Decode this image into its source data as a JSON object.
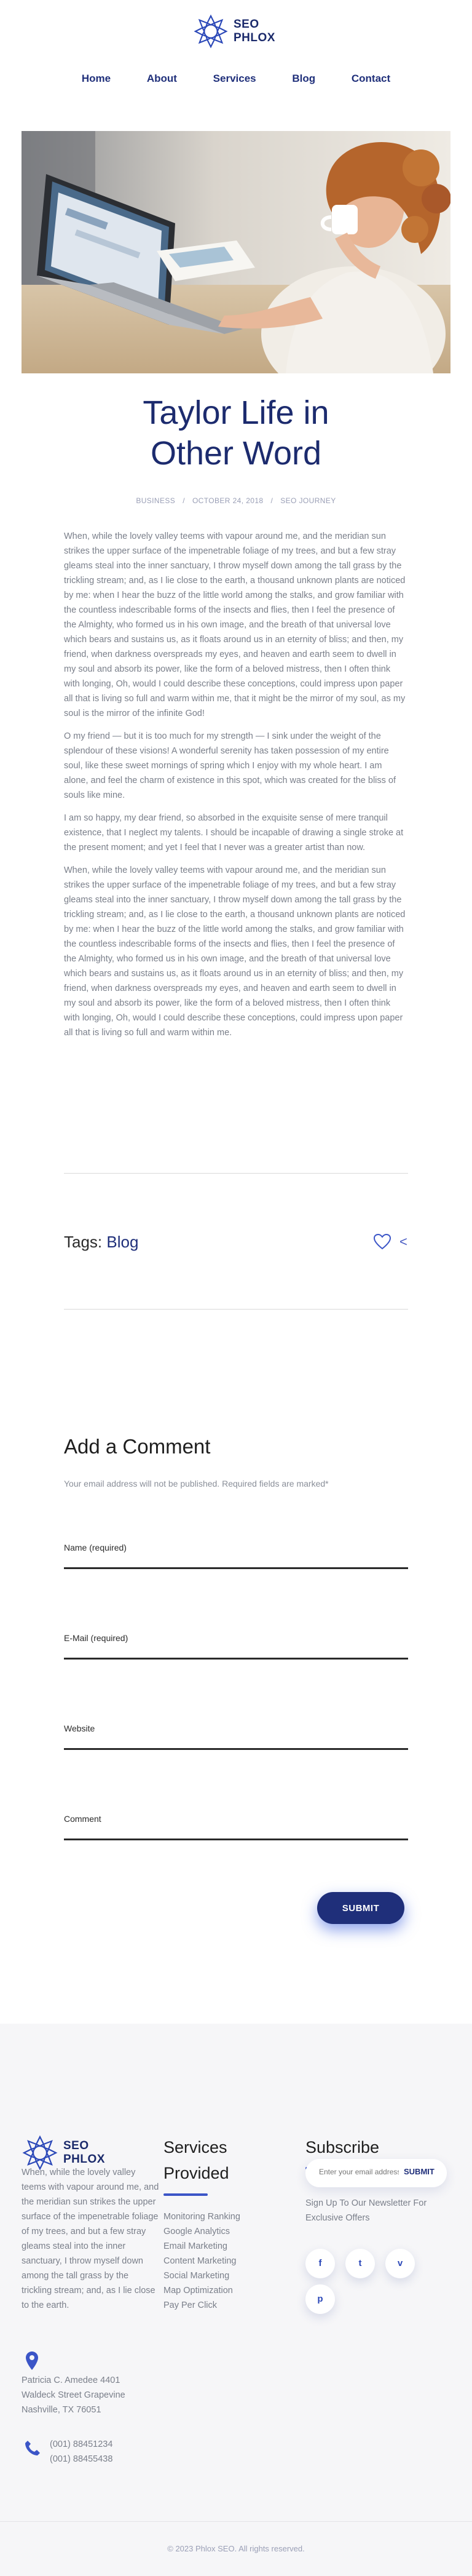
{
  "brand": {
    "line1": "SEO",
    "line2": "PHLOX",
    "accent_color": "#1f2f7a"
  },
  "nav": {
    "items": [
      "Home",
      "About",
      "Services",
      "Blog",
      "Contact"
    ]
  },
  "post": {
    "title_line1": "Taylor Life in",
    "title_line2": "Other Word",
    "meta": {
      "category": "BUSINESS",
      "date": "OCTOBER 24, 2018",
      "author": "SEO JOURNEY"
    },
    "paragraphs": [
      "When, while the lovely valley teems with vapour around me, and the meridian sun strikes the upper surface of the impenetrable foliage of my trees, and but a few stray gleams steal into the inner sanctuary, I throw myself down among the tall grass by the trickling stream; and, as I lie close to the earth, a thousand unknown plants are noticed by me: when I hear the buzz of the little world among the stalks, and grow familiar with the countless indescribable forms of the insects and flies, then I feel the presence of the Almighty, who formed us in his own image, and the breath of that universal love which bears and sustains us, as it floats around us in an eternity of bliss; and then, my friend, when darkness overspreads my eyes, and heaven and earth seem to dwell in my soul and absorb its power, like the form of a beloved mistress, then I often think with longing, Oh, would I could describe these conceptions, could impress upon paper all that is living so full and warm within me, that it might be the mirror of my soul, as my soul is the mirror of the infinite God!",
      "O my friend — but it is too much for my strength — I sink under the weight of the splendour of these visions! A wonderful serenity has taken possession of my entire soul, like these sweet mornings of spring which I enjoy with my whole heart. I am alone, and feel the charm of existence in this spot, which was created for the bliss of souls like mine.",
      "I am so happy, my dear friend, so absorbed in the exquisite sense of mere tranquil existence, that I neglect my talents. I should be incapable of drawing a single stroke at the present moment; and yet I feel that I never was a greater artist than now.",
      "When, while the lovely valley teems with vapour around me, and the meridian sun strikes the upper surface of the impenetrable foliage of my trees, and but a few stray gleams steal into the inner sanctuary, I throw myself down among the tall grass by the trickling stream; and, as I lie close to the earth, a thousand unknown plants are noticed by me: when I hear the buzz of the little world among the stalks, and grow familiar with the countless indescribable forms of the insects and flies, then I feel the presence of the Almighty, who formed us in his own image, and the breath of that universal love which bears and sustains us, as it floats around us in an eternity of bliss; and then, my friend, when darkness overspreads my eyes, and heaven and earth seem to dwell in my soul and absorb its power, like the form of a beloved mistress, then I often think with longing, Oh, would I could describe these conceptions, could impress upon paper all that is living so full and warm within me."
    ],
    "tags_label": "Tags:",
    "tag": "Blog",
    "share_icon": "share-icon",
    "like_icon": "heart-icon"
  },
  "comment": {
    "title": "Add a Comment",
    "note": "Your email address will not be published. Required fields are marked*",
    "fields": {
      "name": "Name (required)",
      "email": "E-Mail (required)",
      "website": "Website",
      "comment": "Comment"
    },
    "submit": "SUBMIT"
  },
  "footer": {
    "about": "When, while the lovely valley teems with vapour around me, and the meridian sun strikes the upper surface of the impenetrable foliage of my trees, and but a few stray gleams steal into the inner sanctuary, I throw myself down among the tall grass by the trickling stream; and, as I lie close to the earth.",
    "address": [
      "Patricia C. Amedee 4401",
      "Waldeck Street Grapevine",
      "Nashville, TX 76051"
    ],
    "phones": [
      "(001) 88451234",
      "(001) 88455438"
    ],
    "services_title_line1": "Services",
    "services_title_line2": "Provided",
    "services": [
      "Monitoring Ranking",
      "Google Analytics",
      "Email Marketing",
      "Content Marketing",
      "Social Marketing",
      "Map Optimization",
      "Pay Per Click"
    ],
    "subscribe_title": "Subscribe",
    "subscribe_placeholder": "Enter your email address",
    "subscribe_button": "SUBMIT",
    "subscribe_text": "Sign Up To Our Newsletter For Exclusive Offers",
    "social": [
      {
        "icon": "facebook-icon",
        "glyph": "f"
      },
      {
        "icon": "twitter-icon",
        "glyph": "t"
      },
      {
        "icon": "vimeo-icon",
        "glyph": "v"
      },
      {
        "icon": "pinterest-icon",
        "glyph": "p"
      }
    ],
    "copyright": "© 2023 Phlox SEO. All rights reserved."
  }
}
